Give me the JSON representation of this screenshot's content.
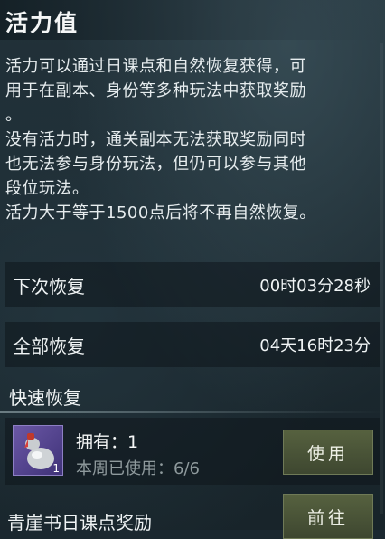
{
  "header": {
    "title": "活力值"
  },
  "description": {
    "p1_l1": "活力可以通过日课点和自然恢复获得，可",
    "p1_l2": "用于在副本、身份等多种玩法中获取奖励",
    "p1_l3": "。",
    "p2_l1": "没有活力时，通关副本无法获取奖励同时",
    "p2_l2": "也无法参与身份玩法，但仍可以参与其他",
    "p2_l3": "段位玩法。",
    "p3": "活力大于等于1500点后将不再自然恢复。"
  },
  "next_recovery": {
    "label": "下次恢复",
    "value": "00时03分28秒"
  },
  "full_recovery": {
    "label": "全部恢复",
    "value": "04天16时23分"
  },
  "quick_recovery": {
    "title": "快速恢复",
    "item": {
      "icon": "potion-gourd-icon",
      "count": "1",
      "own": "拥有：1",
      "used": "本周已使用：6/6",
      "button": "使用"
    }
  },
  "reward": {
    "label": "青崖书日课点奖励",
    "button": "前往"
  },
  "colors": {
    "accent_button": "#4b5538",
    "background": "#1b2830",
    "muted_text": "#8f9a9d"
  }
}
